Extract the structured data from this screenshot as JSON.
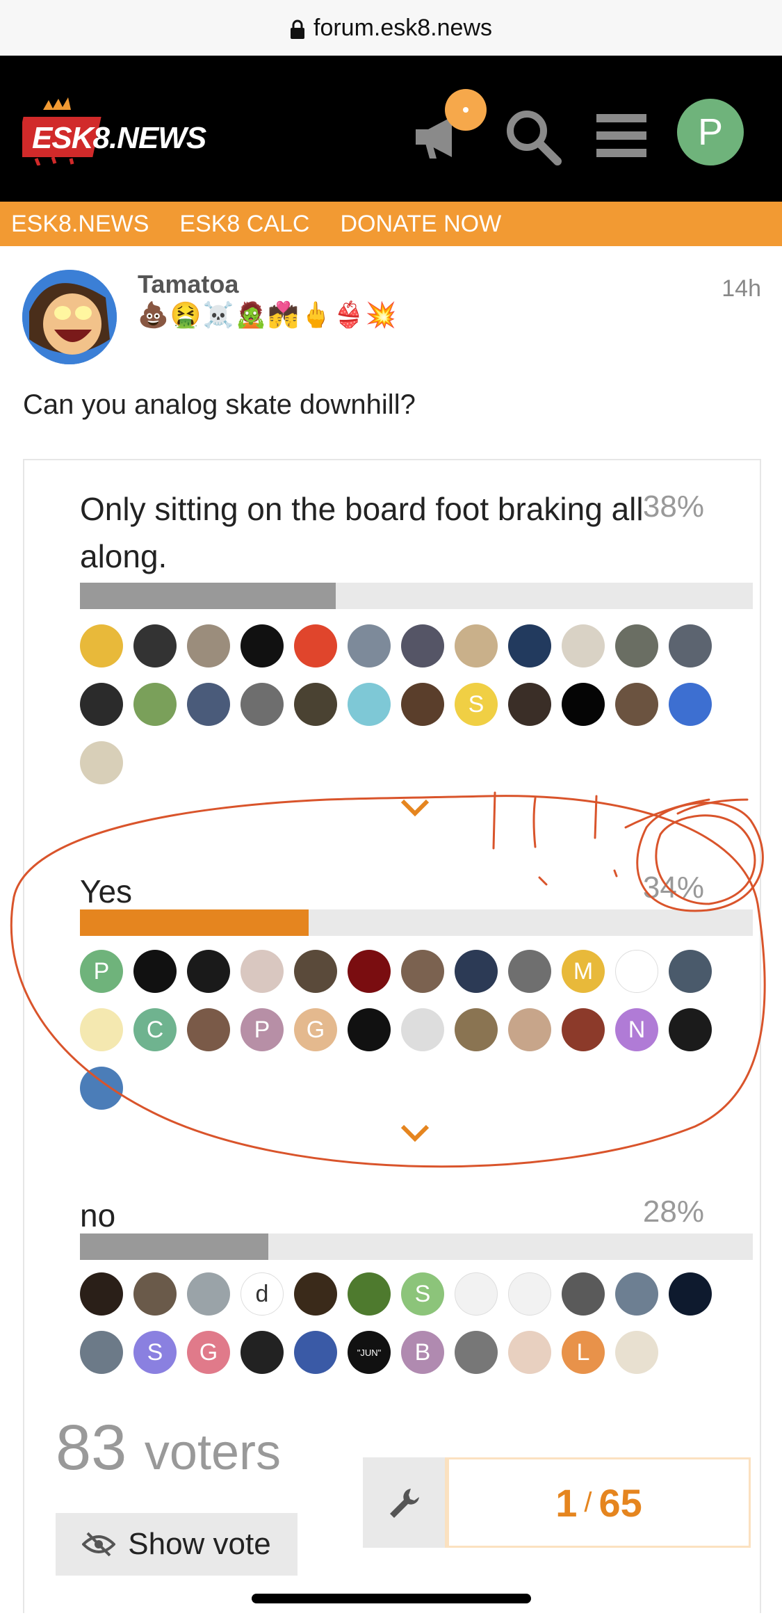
{
  "browser": {
    "url": "forum.esk8.news"
  },
  "header": {
    "logo_text": "ESK8.NEWS",
    "user_initial": "P"
  },
  "nav": {
    "items": [
      "ESK8.NEWS",
      "ESK8 CALC",
      "DONATE NOW"
    ]
  },
  "post": {
    "username": "Tamatoa",
    "flair": "💩🤮☠️🧟💏🖕👙💥",
    "time": "14h",
    "body": "Can you analog skate downhill?"
  },
  "poll": {
    "options": [
      {
        "label": "Only sitting on the board foot braking all along.",
        "percent_text": "38%",
        "percent": 38,
        "voters": [
          {
            "c": "#e8b93a",
            "t": ""
          },
          {
            "c": "#333",
            "t": ""
          },
          {
            "c": "#9b8d7c",
            "t": ""
          },
          {
            "c": "#111",
            "t": ""
          },
          {
            "c": "#e0452c",
            "t": ""
          },
          {
            "c": "#7d8a9a",
            "t": ""
          },
          {
            "c": "#556",
            "t": ""
          },
          {
            "c": "#c9b08a",
            "t": ""
          },
          {
            "c": "#223a5e",
            "t": ""
          },
          {
            "c": "#d9d2c5",
            "t": ""
          },
          {
            "c": "#6a6e63",
            "t": ""
          },
          {
            "c": "#5c6470",
            "t": ""
          },
          {
            "c": "#2b2b2b",
            "t": ""
          },
          {
            "c": "#7aa05a",
            "t": ""
          },
          {
            "c": "#4a5b7a",
            "t": ""
          },
          {
            "c": "#6e6e6e",
            "t": ""
          },
          {
            "c": "#4a4232",
            "t": ""
          },
          {
            "c": "#7ec8d6",
            "t": ""
          },
          {
            "c": "#5a3e2b",
            "t": ""
          },
          {
            "c": "#f0cf44",
            "t": "S"
          },
          {
            "c": "#3a2e27",
            "t": ""
          },
          {
            "c": "#050505",
            "t": ""
          },
          {
            "c": "#6b5340",
            "t": ""
          },
          {
            "c": "#3d6fd1",
            "t": ""
          },
          {
            "c": "#d8cfb8",
            "t": ""
          }
        ]
      },
      {
        "label": "Yes",
        "percent_text": "34%",
        "percent": 34,
        "voters": [
          {
            "c": "#6fb37b",
            "t": "P"
          },
          {
            "c": "#111",
            "t": ""
          },
          {
            "c": "#1a1a1a",
            "t": ""
          },
          {
            "c": "#d9c7c0",
            "t": ""
          },
          {
            "c": "#5a4a3a",
            "t": ""
          },
          {
            "c": "#7a0d10",
            "t": ""
          },
          {
            "c": "#7b6250",
            "t": ""
          },
          {
            "c": "#2c3a55",
            "t": ""
          },
          {
            "c": "#6f6f6f",
            "t": ""
          },
          {
            "c": "#e8b93a",
            "t": "M"
          },
          {
            "c": "#fff",
            "t": ""
          },
          {
            "c": "#4a5a6b",
            "t": ""
          },
          {
            "c": "#f4e8b0",
            "t": ""
          },
          {
            "c": "#6fb38f",
            "t": "C"
          },
          {
            "c": "#7a5a48",
            "t": ""
          },
          {
            "c": "#b78fa6",
            "t": "P"
          },
          {
            "c": "#e4b98e",
            "t": "G"
          },
          {
            "c": "#111",
            "t": ""
          },
          {
            "c": "#ddd",
            "t": ""
          },
          {
            "c": "#8a7452",
            "t": ""
          },
          {
            "c": "#c7a58a",
            "t": ""
          },
          {
            "c": "#8c3a2a",
            "t": ""
          },
          {
            "c": "#b07bd6",
            "t": "N"
          },
          {
            "c": "#1b1b1b",
            "t": ""
          },
          {
            "c": "#4b7db8",
            "t": ""
          }
        ]
      },
      {
        "label": "no",
        "percent_text": "28%",
        "percent": 28,
        "voters": [
          {
            "c": "#2a1f18",
            "t": ""
          },
          {
            "c": "#6a5a4a",
            "t": ""
          },
          {
            "c": "#9aa3a8",
            "t": ""
          },
          {
            "c": "#fff",
            "t": "d"
          },
          {
            "c": "#3a2a1a",
            "t": ""
          },
          {
            "c": "#4e7a2e",
            "t": ""
          },
          {
            "c": "#8cc47a",
            "t": "S"
          },
          {
            "c": "#f2f2f2",
            "t": ""
          },
          {
            "c": "#f2f2f2",
            "t": ""
          },
          {
            "c": "#5a5a5a",
            "t": ""
          },
          {
            "c": "#6d7f92",
            "t": ""
          },
          {
            "c": "#0e1a2e",
            "t": ""
          },
          {
            "c": "#6c7a88",
            "t": ""
          },
          {
            "c": "#8a80e0",
            "t": "S"
          },
          {
            "c": "#e07a8a",
            "t": "G"
          },
          {
            "c": "#222",
            "t": ""
          },
          {
            "c": "#3a5aa6",
            "t": ""
          },
          {
            "c": "#111",
            "t": "\"JUN\""
          },
          {
            "c": "#b08ab0",
            "t": "B"
          },
          {
            "c": "#777",
            "t": ""
          },
          {
            "c": "#e8d0c0",
            "t": ""
          },
          {
            "c": "#e8924a",
            "t": "L"
          },
          {
            "c": "#e8e0d0",
            "t": ""
          }
        ]
      }
    ],
    "voter_count": "83",
    "voter_word": "voters",
    "show_vote_label": "Show vote"
  },
  "timeline": {
    "current": "1",
    "total": "65"
  },
  "colors": {
    "accent": "#e5851f",
    "nav": "#f29a33",
    "annotation": "#d9542b"
  }
}
